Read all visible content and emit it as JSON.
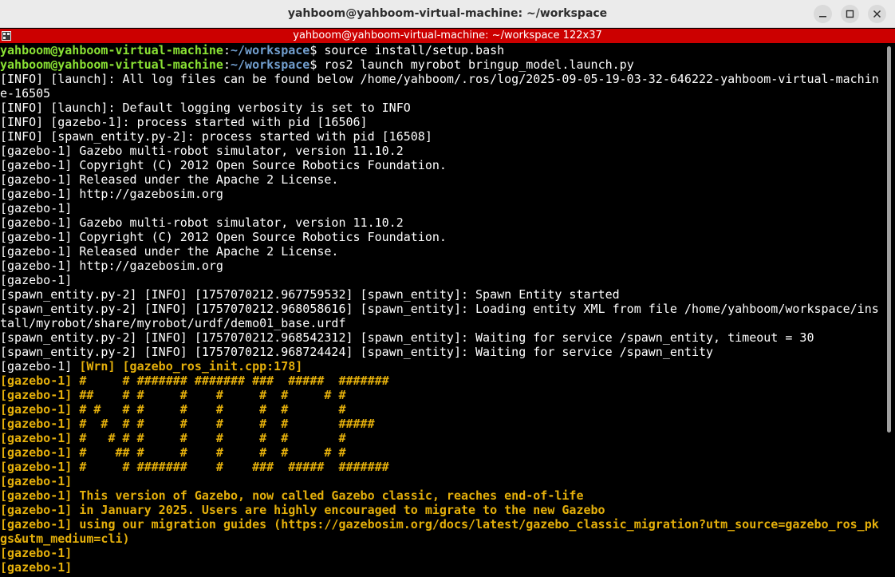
{
  "window": {
    "title": "yahboom@yahboom-virtual-machine: ~/workspace",
    "minimize_icon": "minimize-icon",
    "maximize_icon": "maximize-icon",
    "close_icon": "close-icon"
  },
  "tmux": {
    "title": "yahboom@yahboom-virtual-machine: ~/workspace 122x37",
    "bar_color": "#cc0000",
    "icon": "terminal-icon"
  },
  "colors": {
    "user": "#8ae234",
    "path": "#729fcf",
    "text": "#ffffff",
    "warning": "#e5b00b",
    "background": "#000000"
  },
  "terminal": {
    "lines": [
      {
        "type": "prompt",
        "user": "yahboom@yahboom-virtual-machine",
        "sep": ":",
        "path": "~/workspace",
        "sym": "$ ",
        "cmd": "source install/setup.bash"
      },
      {
        "type": "prompt",
        "user": "yahboom@yahboom-virtual-machine",
        "sep": ":",
        "path": "~/workspace",
        "sym": "$ ",
        "cmd": "ros2 launch myrobot bringup_model.launch.py"
      },
      {
        "type": "plain",
        "text": "[INFO] [launch]: All log files can be found below /home/yahboom/.ros/log/2025-09-05-19-03-32-646222-yahboom-virtual-machin"
      },
      {
        "type": "plain",
        "text": "e-16505"
      },
      {
        "type": "plain",
        "text": "[INFO] [launch]: Default logging verbosity is set to INFO"
      },
      {
        "type": "plain",
        "text": "[INFO] [gazebo-1]: process started with pid [16506]"
      },
      {
        "type": "plain",
        "text": "[INFO] [spawn_entity.py-2]: process started with pid [16508]"
      },
      {
        "type": "plain",
        "text": "[gazebo-1] Gazebo multi-robot simulator, version 11.10.2"
      },
      {
        "type": "plain",
        "text": "[gazebo-1] Copyright (C) 2012 Open Source Robotics Foundation."
      },
      {
        "type": "plain",
        "text": "[gazebo-1] Released under the Apache 2 License."
      },
      {
        "type": "plain",
        "text": "[gazebo-1] http://gazebosim.org"
      },
      {
        "type": "plain",
        "text": "[gazebo-1]"
      },
      {
        "type": "plain",
        "text": "[gazebo-1] Gazebo multi-robot simulator, version 11.10.2"
      },
      {
        "type": "plain",
        "text": "[gazebo-1] Copyright (C) 2012 Open Source Robotics Foundation."
      },
      {
        "type": "plain",
        "text": "[gazebo-1] Released under the Apache 2 License."
      },
      {
        "type": "plain",
        "text": "[gazebo-1] http://gazebosim.org"
      },
      {
        "type": "plain",
        "text": "[gazebo-1]"
      },
      {
        "type": "plain",
        "text": "[spawn_entity.py-2] [INFO] [1757070212.967759532] [spawn_entity]: Spawn Entity started"
      },
      {
        "type": "plain",
        "text": "[spawn_entity.py-2] [INFO] [1757070212.968058616] [spawn_entity]: Loading entity XML from file /home/yahboom/workspace/ins"
      },
      {
        "type": "plain",
        "text": "tall/myrobot/share/myrobot/urdf/demo01_base.urdf"
      },
      {
        "type": "plain",
        "text": "[spawn_entity.py-2] [INFO] [1757070212.968542312] [spawn_entity]: Waiting for service /spawn_entity, timeout = 30"
      },
      {
        "type": "plain",
        "text": "[spawn_entity.py-2] [INFO] [1757070212.968724424] [spawn_entity]: Waiting for service /spawn_entity"
      },
      {
        "type": "mixed",
        "prefix": "[gazebo-1] ",
        "rest": "[Wrn] [gazebo_ros_init.cpp:178]"
      },
      {
        "type": "warn",
        "text": "[gazebo-1] #     # ####### ####### ###  #####  #######"
      },
      {
        "type": "warn",
        "text": "[gazebo-1] ##    # #     #    #     #  #     # #"
      },
      {
        "type": "warn",
        "text": "[gazebo-1] # #   # #     #    #     #  #       #"
      },
      {
        "type": "warn",
        "text": "[gazebo-1] #  #  # #     #    #     #  #       #####"
      },
      {
        "type": "warn",
        "text": "[gazebo-1] #   # # #     #    #     #  #       #"
      },
      {
        "type": "warn",
        "text": "[gazebo-1] #    ## #     #    #     #  #     # #"
      },
      {
        "type": "warn",
        "text": "[gazebo-1] #     # #######    #    ###  #####  #######"
      },
      {
        "type": "warn",
        "text": "[gazebo-1]"
      },
      {
        "type": "warn",
        "text": "[gazebo-1] This version of Gazebo, now called Gazebo classic, reaches end-of-life"
      },
      {
        "type": "warn",
        "text": "[gazebo-1] in January 2025. Users are highly encouraged to migrate to the new Gazebo"
      },
      {
        "type": "warn",
        "text": "[gazebo-1] using our migration guides (https://gazebosim.org/docs/latest/gazebo_classic_migration?utm_source=gazebo_ros_pk"
      },
      {
        "type": "warn",
        "text": "gs&utm_medium=cli)"
      },
      {
        "type": "warn",
        "text": "[gazebo-1]"
      },
      {
        "type": "warn",
        "text": "[gazebo-1]"
      }
    ]
  }
}
